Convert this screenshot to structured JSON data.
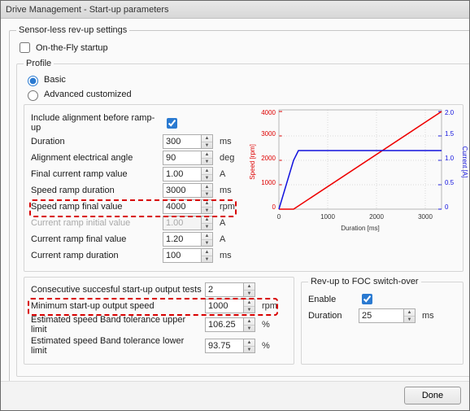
{
  "window": {
    "title": "Drive Management - Start-up parameters"
  },
  "sensorless": {
    "legend": "Sensor-less rev-up settings",
    "on_the_fly": "On-the-Fly startup",
    "profile_legend": "Profile",
    "basic": "Basic",
    "advanced": "Advanced customized"
  },
  "fields": {
    "include_align": "Include alignment before ramp-up",
    "duration": {
      "label": "Duration",
      "value": "300",
      "unit": "ms"
    },
    "align_angle": {
      "label": "Alignment electrical angle",
      "value": "90",
      "unit": "deg"
    },
    "final_cur_ramp": {
      "label": "Final current ramp value",
      "value": "1.00",
      "unit": "A"
    },
    "speed_ramp_dur": {
      "label": "Speed ramp duration",
      "value": "3000",
      "unit": "ms"
    },
    "speed_ramp_final": {
      "label": "Speed ramp final value",
      "value": "4000",
      "unit": "rpm"
    },
    "cur_ramp_init": {
      "label": "Current ramp initial value",
      "value": "1.00",
      "unit": "A"
    },
    "cur_ramp_final": {
      "label": "Current ramp final value",
      "value": "1.20",
      "unit": "A"
    },
    "cur_ramp_dur": {
      "label": "Current ramp duration",
      "value": "100",
      "unit": "ms"
    }
  },
  "lower": {
    "consec": {
      "label": "Consecutive succesful start-up output tests",
      "value": "2"
    },
    "min_speed": {
      "label": "Minimum start-up output speed",
      "value": "1000",
      "unit": "rpm"
    },
    "band_upper": {
      "label": "Estimated speed Band tolerance upper limit",
      "value": "106.25",
      "unit": "%"
    },
    "band_lower": {
      "label": "Estimated speed Band tolerance lower limit",
      "value": "93.75",
      "unit": "%"
    }
  },
  "switch_over": {
    "legend": "Rev-up to FOC switch-over",
    "enable": "Enable",
    "duration": {
      "label": "Duration",
      "value": "25",
      "unit": "ms"
    }
  },
  "done": "Done",
  "chart_data": {
    "type": "line",
    "xlabel": "Duration [ms]",
    "ylabel_left": "Speed [rpm]",
    "ylabel_right": "Current [A]",
    "xlim": [
      0,
      3300
    ],
    "ylim_left": [
      0,
      4000
    ],
    "ylim_right": [
      0,
      2.0
    ],
    "x_ticks": [
      0,
      1000,
      2000,
      3000
    ],
    "y_ticks_left": [
      0,
      1000,
      2000,
      3000,
      4000
    ],
    "y_ticks_right": [
      0,
      0.5,
      1.0,
      1.5,
      2.0
    ],
    "series": [
      {
        "name": "Speed",
        "color": "red",
        "axis": "left",
        "x": [
          0,
          300,
          3300
        ],
        "y": [
          0,
          0,
          4000
        ]
      },
      {
        "name": "Current",
        "color": "blue",
        "axis": "right",
        "x": [
          0,
          300,
          400,
          3300
        ],
        "y": [
          0,
          1.0,
          1.2,
          1.2
        ]
      }
    ]
  }
}
